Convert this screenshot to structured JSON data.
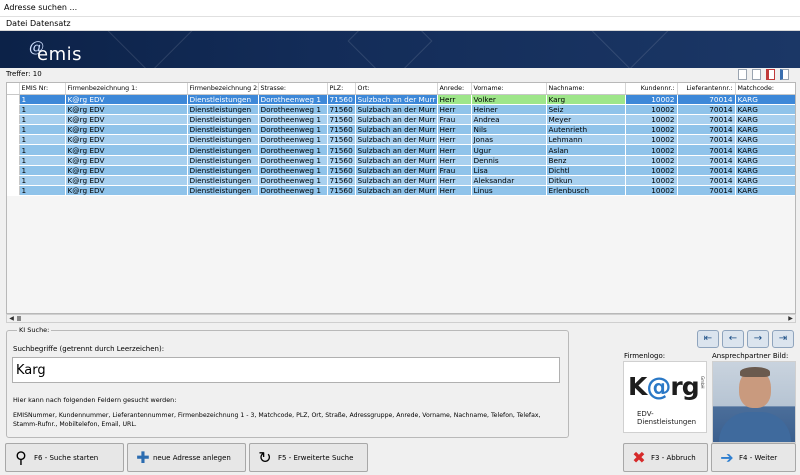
{
  "window": {
    "title": "Adresse suchen ..."
  },
  "menu": [
    "Datei",
    "Datensatz"
  ],
  "brand": {
    "logo_text": "emis",
    "logo_mark": "@"
  },
  "hits_label": "Treffer: 10",
  "grid": {
    "columns": [
      "EMIS Nr:",
      "Firmenbezeichnung 1:",
      "Firmenbezeichnung 2:",
      "Strasse:",
      "PLZ:",
      "Ort:",
      "Anrede:",
      "Vorname:",
      "Nachname:",
      "Kundennr.:",
      "Lieferantennr.:",
      "Matchcode:"
    ],
    "rows": [
      [
        "1",
        "K@rg EDV",
        "Dienstleistungen",
        "Dorotheenweg 1",
        "71560",
        "Sulzbach an der Murr",
        "Herr",
        "Volker",
        "Karg",
        "10002",
        "70014",
        "KARG"
      ],
      [
        "1",
        "K@rg EDV",
        "Dienstleistungen",
        "Dorotheenweg 1",
        "71560",
        "Sulzbach an der Murr",
        "Herr",
        "Heiner",
        "Seiz",
        "10002",
        "70014",
        "KARG"
      ],
      [
        "1",
        "K@rg EDV",
        "Dienstleistungen",
        "Dorotheenweg 1",
        "71560",
        "Sulzbach an der Murr",
        "Frau",
        "Andrea",
        "Meyer",
        "10002",
        "70014",
        "KARG"
      ],
      [
        "1",
        "K@rg EDV",
        "Dienstleistungen",
        "Dorotheenweg 1",
        "71560",
        "Sulzbach an der Murr",
        "Herr",
        "Nils",
        "Autenrieth",
        "10002",
        "70014",
        "KARG"
      ],
      [
        "1",
        "K@rg EDV",
        "Dienstleistungen",
        "Dorotheenweg 1",
        "71560",
        "Sulzbach an der Murr",
        "Herr",
        "Jonas",
        "Lehmann",
        "10002",
        "70014",
        "KARG"
      ],
      [
        "1",
        "K@rg EDV",
        "Dienstleistungen",
        "Dorotheenweg 1",
        "71560",
        "Sulzbach an der Murr",
        "Herr",
        "Ugur",
        "Aslan",
        "10002",
        "70014",
        "KARG"
      ],
      [
        "1",
        "K@rg EDV",
        "Dienstleistungen",
        "Dorotheenweg 1",
        "71560",
        "Sulzbach an der Murr",
        "Herr",
        "Dennis",
        "Benz",
        "10002",
        "70014",
        "KARG"
      ],
      [
        "1",
        "K@rg EDV",
        "Dienstleistungen",
        "Dorotheenweg 1",
        "71560",
        "Sulzbach an der Murr",
        "Frau",
        "Lisa",
        "Dichtl",
        "10002",
        "70014",
        "KARG"
      ],
      [
        "1",
        "K@rg EDV",
        "Dienstleistungen",
        "Dorotheenweg 1",
        "71560",
        "Sulzbach an der Murr",
        "Herr",
        "Aleksandar",
        "Ditkun",
        "10002",
        "70014",
        "KARG"
      ],
      [
        "1",
        "K@rg EDV",
        "Dienstleistungen",
        "Dorotheenweg 1",
        "71560",
        "Sulzbach an der Murr",
        "Herr",
        "Linus",
        "Erlenbusch",
        "10002",
        "70014",
        "KARG"
      ]
    ],
    "selected_row": 0,
    "current_row_marker": "▶"
  },
  "ki_search": {
    "legend": "KI Suche:",
    "label": "Suchbegriffe (getrennt durch Leerzeichen):",
    "value": "Karg",
    "hint": "Hier kann nach folgenden Feldern gesucht werden:",
    "fields": "EMISNummer, Kundennummer, Lieferantennummer, Firmenbezeichnung 1 - 3, Matchcode, PLZ, Ort, Straße, Adressgruppe, Anrede, Vorname, Nachname, Telefon, Telefax, Stamm-Rufnr., Mobiltelefon, Email, URL."
  },
  "company_logo": {
    "label": "Firmenlogo:",
    "name_start": "K",
    "name_at": "@",
    "name_end": "rg",
    "gmbh": "GmbH",
    "subtitle": "EDV-Dienstleistungen"
  },
  "contact_photo": {
    "label": "Ansprechpartner Bild:"
  },
  "buttons": {
    "search": "F6 - Suche starten",
    "new_address": "neue Adresse anlegen",
    "extended_search": "F5 - Erweiterte Suche",
    "cancel": "F3 - Abbruch",
    "next": "F4 - Weiter"
  },
  "nav": {
    "first": "⇤",
    "prev": "←",
    "next": "→",
    "last": "⇥"
  },
  "colors": {
    "banner": "#132c58",
    "row": "#8fc3ea",
    "row_alt": "#a8d0ef",
    "row_selected": "#3d88d8",
    "cell_highlight": "#9ee68a"
  }
}
